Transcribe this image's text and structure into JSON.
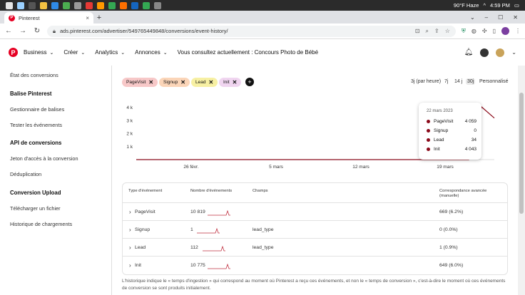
{
  "taskbar": {
    "weather": "90°F  Haze",
    "time": "4:59 PM"
  },
  "browser": {
    "tab_title": "Pinterest",
    "tab_close": "×",
    "new_tab": "+",
    "url": "ads.pinterest.com/advertiser/549765449848/conversions/event-history/",
    "win_min": "–",
    "win_max": "☐",
    "win_close": "✕"
  },
  "header": {
    "logo": "P",
    "nav": [
      {
        "label": "Business"
      },
      {
        "label": "Créer"
      },
      {
        "label": "Analytics"
      },
      {
        "label": "Annonces"
      }
    ],
    "context": "Vous consultez actuellement : Concours Photo de Bébé"
  },
  "sidebar": {
    "items": [
      {
        "label": "État des conversions",
        "type": "item"
      },
      {
        "label": "Balise Pinterest",
        "type": "head"
      },
      {
        "label": "Gestionnaire de balises",
        "type": "item"
      },
      {
        "label": "Tester les événements",
        "type": "item"
      },
      {
        "label": "API de conversions",
        "type": "head"
      },
      {
        "label": "Jeton d'accès à la conversion",
        "type": "item"
      },
      {
        "label": "Déduplication",
        "type": "item"
      },
      {
        "label": "Conversion Upload",
        "type": "head"
      },
      {
        "label": "Télécharger un fichier",
        "type": "item"
      },
      {
        "label": "Historique de chargements",
        "type": "item"
      }
    ]
  },
  "filters": {
    "chips": [
      {
        "label": "PageVisit",
        "color": "#f7c8c8"
      },
      {
        "label": "Signup",
        "color": "#fbd5b8"
      },
      {
        "label": "Lead",
        "color": "#f7f0a3"
      },
      {
        "label": "Init",
        "color": "#f0d5f0"
      }
    ],
    "remove_glyph": "✕",
    "add_glyph": "+"
  },
  "ranges": [
    {
      "label": "3j (par heure)",
      "selected": false
    },
    {
      "label": "7j",
      "selected": false
    },
    {
      "label": "14 j",
      "selected": false
    },
    {
      "label": "30j",
      "selected": true
    },
    {
      "label": "Personnalisé",
      "selected": false
    }
  ],
  "chart_data": {
    "type": "line",
    "y_ticks": [
      "4 k",
      "3 k",
      "2 k",
      "1 k"
    ],
    "x_ticks": [
      "26 févr.",
      "5 mars",
      "12 mars",
      "19 mars"
    ],
    "ylim": [
      0,
      4500
    ],
    "series_color": "#8b0a1a",
    "series": [
      {
        "name": "PageVisit",
        "values": [
          0,
          0,
          0,
          0,
          0,
          0,
          0,
          0,
          0,
          0,
          0,
          0,
          0,
          0,
          0,
          0,
          0,
          0,
          0,
          0,
          0,
          0,
          0,
          0,
          0,
          0,
          0,
          4059,
          3200
        ]
      }
    ]
  },
  "tooltip": {
    "date": "22 mars 2023",
    "rows": [
      {
        "label": "PageVisit",
        "value": "4 059"
      },
      {
        "label": "Signup",
        "value": "0"
      },
      {
        "label": "Lead",
        "value": "34"
      },
      {
        "label": "Init",
        "value": "4 043"
      }
    ]
  },
  "table": {
    "headers": {
      "type": "Type d'événement",
      "count": "Nombre d'événements",
      "fields": "Champs",
      "match": "Correspondance avancée",
      "match_sub": "(manuelle)"
    },
    "rows": [
      {
        "event": "PageVisit",
        "count": "10 819",
        "fields": "",
        "match": "669 (6.2%)"
      },
      {
        "event": "Signup",
        "count": "1",
        "fields": "lead_type",
        "match": "0 (0.0%)"
      },
      {
        "event": "Lead",
        "count": "112",
        "fields": "lead_type",
        "match": "1 (0.9%)"
      },
      {
        "event": "Init",
        "count": "10 775",
        "fields": "",
        "match": "649 (6.0%)"
      }
    ],
    "row_chevron": "›"
  },
  "footer_note": "L'historique indique le « temps d'ingestion » qui correspond au moment où Pinterest a reçu ces événements, et non le « temps de conversion », c'est-à-dire le moment où ces événements de conversion se sont produits initialement."
}
